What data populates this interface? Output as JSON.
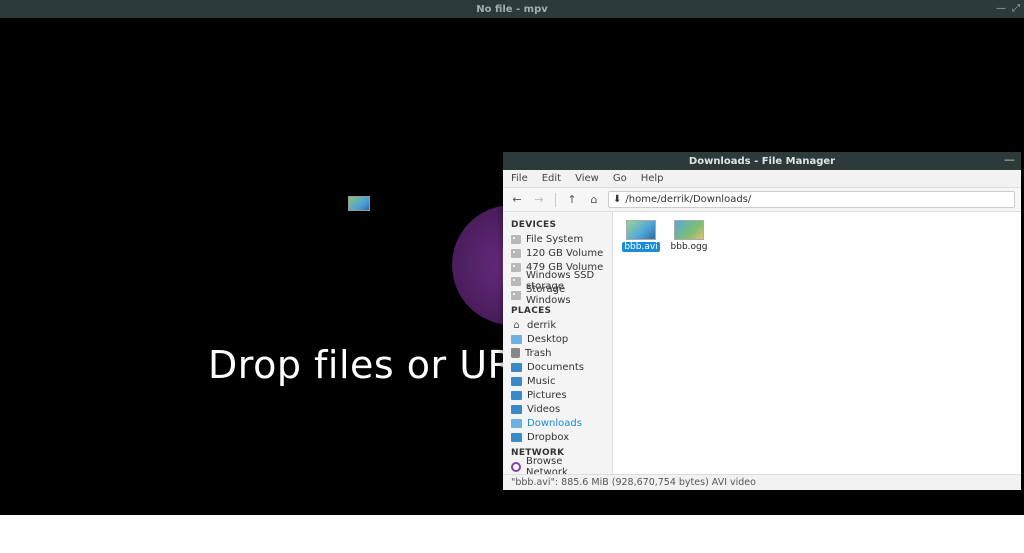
{
  "mpv": {
    "title": "No file - mpv",
    "drop_text": "Drop files or URLs to play here.",
    "ctrl_min": "—",
    "ctrl_max": "⤢"
  },
  "fm": {
    "title": "Downloads - File Manager",
    "close": "—",
    "menu": {
      "file": "File",
      "edit": "Edit",
      "view": "View",
      "go": "Go",
      "help": "Help"
    },
    "toolbar": {
      "back": "←",
      "fwd": "→",
      "up": "↑",
      "home": "⌂",
      "path_icon": "⬇"
    },
    "path": "/home/derrik/Downloads/",
    "sidebar": {
      "devices_hdr": "DEVICES",
      "devices": [
        {
          "label": "File System"
        },
        {
          "label": "120 GB Volume"
        },
        {
          "label": "479 GB Volume"
        },
        {
          "label": "Windows SSD storage"
        },
        {
          "label": "Storage Windows"
        }
      ],
      "places_hdr": "PLACES",
      "places": [
        {
          "label": "derrik",
          "icon": "home"
        },
        {
          "label": "Desktop",
          "icon": "folder"
        },
        {
          "label": "Trash",
          "icon": "trash"
        },
        {
          "label": "Documents",
          "icon": "folder"
        },
        {
          "label": "Music",
          "icon": "folder"
        },
        {
          "label": "Pictures",
          "icon": "folder"
        },
        {
          "label": "Videos",
          "icon": "folder"
        },
        {
          "label": "Downloads",
          "icon": "folder",
          "sel": true
        },
        {
          "label": "Dropbox",
          "icon": "folder"
        }
      ],
      "network_hdr": "NETWORK",
      "network": [
        {
          "label": "Browse Network"
        }
      ]
    },
    "files": [
      {
        "label": "bbb.avi",
        "sel": true,
        "thumb": "a"
      },
      {
        "label": "bbb.ogg",
        "sel": false,
        "thumb": "b"
      }
    ],
    "status": "\"bbb.avi\": 885.6 MiB (928,670,754 bytes) AVI video"
  }
}
